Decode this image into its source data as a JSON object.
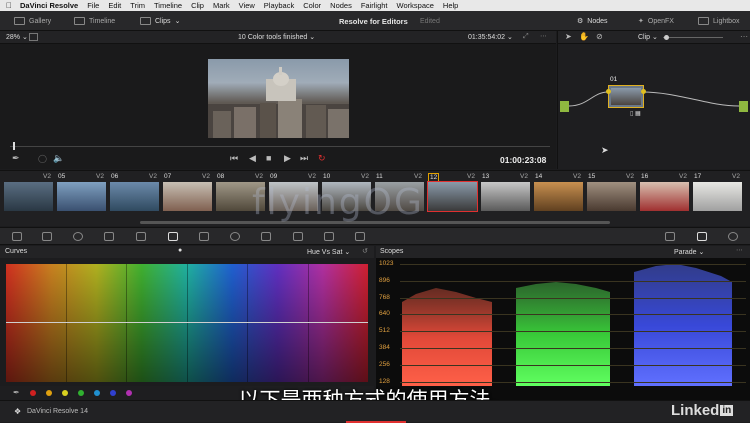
{
  "menubar": {
    "apple": "",
    "app_name": "DaVinci Resolve",
    "items": [
      "File",
      "Edit",
      "Trim",
      "Timeline",
      "Clip",
      "Mark",
      "View",
      "Playback",
      "Color",
      "Nodes",
      "Fairlight",
      "Workspace",
      "Help"
    ]
  },
  "topbar": {
    "gallery": "Gallery",
    "timeline": "Timeline",
    "clips": "Clips",
    "project_title": "Resolve for Editors",
    "project_status": "Edited",
    "nodes": "Nodes",
    "openfx": "OpenFX",
    "lightbox": "Lightbox"
  },
  "viewer": {
    "zoom": "28%",
    "timeline_name": "10 Color tools finished",
    "source_timecode": "01:35:54:02",
    "record_timecode": "01:00:23:08"
  },
  "node_editor": {
    "mode": "Clip",
    "node_label": "01"
  },
  "clips": [
    {
      "num": "",
      "track": "V2",
      "selected": false,
      "colors": [
        "#5a6e82",
        "#2a3844"
      ]
    },
    {
      "num": "05",
      "track": "V2",
      "selected": false,
      "colors": [
        "#7fa0c0",
        "#3a5070"
      ]
    },
    {
      "num": "06",
      "track": "V2",
      "selected": false,
      "colors": [
        "#6b8aaa",
        "#304a60"
      ]
    },
    {
      "num": "07",
      "track": "V2",
      "selected": false,
      "colors": [
        "#c8c0b4",
        "#806050"
      ]
    },
    {
      "num": "08",
      "track": "V2",
      "selected": false,
      "colors": [
        "#a09888",
        "#50483a"
      ]
    },
    {
      "num": "09",
      "track": "V2",
      "selected": false,
      "colors": [
        "#bfc4c8",
        "#6a6058"
      ]
    },
    {
      "num": "10",
      "track": "V2",
      "selected": false,
      "colors": [
        "#b0b8c0",
        "#4a4640"
      ]
    },
    {
      "num": "11",
      "track": "V2",
      "selected": false,
      "colors": [
        "#9aa0a4",
        "#504a44"
      ]
    },
    {
      "num": "12",
      "track": "V2",
      "selected": true,
      "colors": [
        "#8a9aaa",
        "#3a3a3a"
      ]
    },
    {
      "num": "13",
      "track": "V2",
      "selected": false,
      "colors": [
        "#c8c8c8",
        "#5a5a5a"
      ]
    },
    {
      "num": "14",
      "track": "V2",
      "selected": false,
      "colors": [
        "#c89050",
        "#604020"
      ]
    },
    {
      "num": "15",
      "track": "V2",
      "selected": false,
      "colors": [
        "#a09080",
        "#4a3a30"
      ]
    },
    {
      "num": "16",
      "track": "V2",
      "selected": false,
      "colors": [
        "#d8c0b0",
        "#a03030"
      ]
    },
    {
      "num": "17",
      "track": "V2",
      "selected": false,
      "colors": [
        "#e8e8e4",
        "#a0a0a0"
      ]
    }
  ],
  "curves": {
    "title": "Curves",
    "mode": "Hue Vs Sat",
    "swatches": [
      "#d02020",
      "#e0a010",
      "#d8d020",
      "#30b030",
      "#2090d0",
      "#3040d0",
      "#b030b0"
    ]
  },
  "scopes": {
    "title": "Scopes",
    "mode": "Parade",
    "ticks": [
      "1023",
      "896",
      "768",
      "640",
      "512",
      "384",
      "256",
      "128"
    ]
  },
  "footer": {
    "app_version": "DaVinci Resolve 14"
  },
  "overlay": {
    "subtitle": "以下是两种方式的使用方法。",
    "watermark": "flyingOG",
    "brand": "Linked"
  }
}
